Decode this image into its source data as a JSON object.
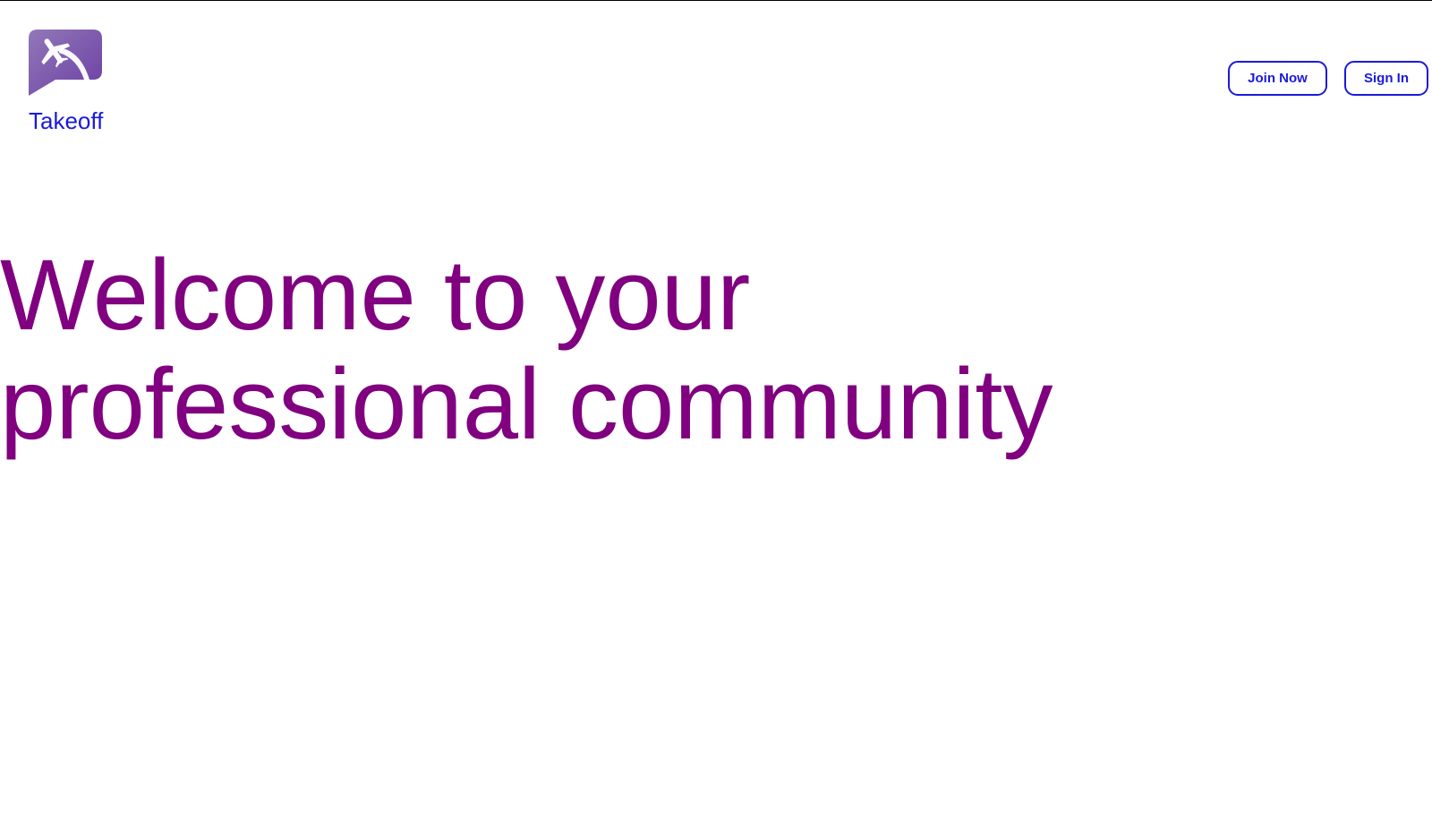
{
  "brand": {
    "name": "Takeoff",
    "logo_icon": "airplane-takeoff-icon",
    "logo_gradient": [
      "#8d6ab3",
      "#6a3fa3"
    ]
  },
  "nav": {
    "join_label": "Join Now",
    "signin_label": "Sign In"
  },
  "hero": {
    "title": "Welcome to your professional community"
  },
  "colors": {
    "accent": "#1a1adb",
    "hero_text": "#800080",
    "background": "#ffffff"
  }
}
